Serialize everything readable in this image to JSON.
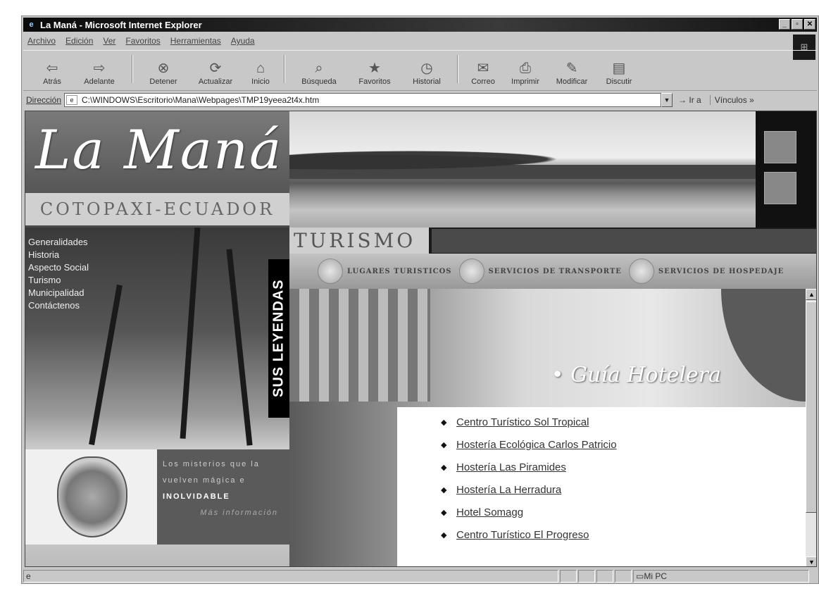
{
  "window": {
    "title": "La Maná - Microsoft Internet Explorer",
    "buttons": [
      "_",
      "▫",
      "✕"
    ]
  },
  "menu": [
    "Archivo",
    "Edición",
    "Ver",
    "Favoritos",
    "Herramientas",
    "Ayuda"
  ],
  "toolbar": [
    {
      "label": "Atrás",
      "icon": "back-arrow-icon",
      "glyph": "⇦"
    },
    {
      "label": "Adelante",
      "icon": "forward-arrow-icon",
      "glyph": "⇨"
    },
    {
      "label": "Detener",
      "icon": "stop-icon",
      "glyph": "⊗"
    },
    {
      "label": "Actualizar",
      "icon": "refresh-icon",
      "glyph": "⟳"
    },
    {
      "label": "Inicio",
      "icon": "home-icon",
      "glyph": "⌂"
    },
    {
      "label": "Búsqueda",
      "icon": "search-icon",
      "glyph": "⌕"
    },
    {
      "label": "Favoritos",
      "icon": "favorites-icon",
      "glyph": "★"
    },
    {
      "label": "Historial",
      "icon": "history-icon",
      "glyph": "◷"
    },
    {
      "label": "Correo",
      "icon": "mail-icon",
      "glyph": "✉"
    },
    {
      "label": "Imprimir",
      "icon": "print-icon",
      "glyph": "⎙"
    },
    {
      "label": "Modificar",
      "icon": "edit-icon",
      "glyph": "✎"
    },
    {
      "label": "Discutir",
      "icon": "discuss-icon",
      "glyph": "▤"
    }
  ],
  "address": {
    "label": "Dirección",
    "value": "C:\\WINDOWS\\Escritorio\\Mana\\Webpages\\TMP19yeea2t4x.htm",
    "go": "Ir a",
    "links": "Vínculos »"
  },
  "site": {
    "logo_script": "La Maná",
    "logo_band": "COTOPAXI-ECUADOR",
    "nav": [
      "Generalidades",
      "Historia",
      "Aspecto Social",
      "Turismo",
      "Municipalidad",
      "Contáctenos"
    ],
    "leyendas": "SUS LEYENDAS",
    "turismo": "TURISMO",
    "tabs": [
      "LUGARES TURISTICOS",
      "SERVICIOS DE TRANSPORTE",
      "SERVICIOS DE HOSPEDAJE"
    ],
    "guia": "Guía Hotelera",
    "hotels": [
      "Centro Turístico Sol Tropical",
      "Hostería Ecológica Carlos Patricio",
      "Hostería Las Piramides",
      "Hostería La Herradura",
      "Hotel Somagg",
      "Centro Turístico El Progreso"
    ],
    "tagline": [
      "Los misterios que la",
      "vuelven mágica e",
      "INOLVIDABLE",
      "Más información"
    ]
  },
  "status": {
    "zone": "Mi PC"
  }
}
